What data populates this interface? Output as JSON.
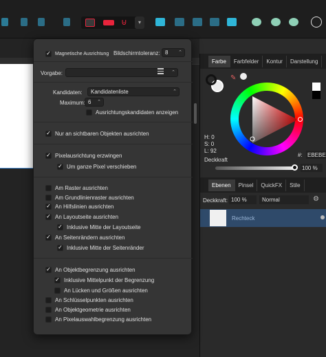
{
  "toolbar": {
    "dropdown_arrow": "▾",
    "user_icon": "user-icon"
  },
  "snapping": {
    "magnetic_label": "Magnetische Ausrichtung",
    "tolerance_label": "Bildschirmtoleranz:",
    "tolerance_value": "8",
    "preset_label": "Vorgabe:",
    "preset_value": "",
    "candidates_label": "Kandidaten:",
    "candidates_value": "Kandidatenliste",
    "maximum_label": "Maximum:",
    "maximum_value": "6",
    "show_candidates_label": "Ausrichtungskandidaten anzeigen",
    "visible_only_label": "Nur an sichtbaren Objekten ausrichten",
    "pixel_align_label": "Pixelausrichtung erzwingen",
    "whole_pixels_label": "Um ganze Pixel verschieben",
    "grid_label": "Am Raster ausrichten",
    "baseline_grid_label": "Am Grundlinienraster ausrichten",
    "guides_label": "An Hilfslinien ausrichten",
    "layout_label": "An Layoutseite ausrichten",
    "layout_mid_label": "Inklusive Mitte der Layoutseite",
    "page_edges_label": "An Seitenrändern ausrichten",
    "page_edges_mid_label": "Inklusive Mitte der Seitenränder",
    "object_bounds_label": "An Objektbegrenzung ausrichten",
    "bounds_mid_label": "Inklusive Mittelpunkt der Begrenzung",
    "gaps_label": "An Lücken und Größen ausrichten",
    "keypoints_label": "An Schlüsselpunkten ausrichten",
    "geometry_label": "An Objektgeometrie ausrichten",
    "pixel_selection_label": "An Pixelauswahlbegrenzung ausrichten",
    "checked": "✓"
  },
  "color_panel": {
    "tabs": [
      "Farbe",
      "Farbfelder",
      "Kontur",
      "Darstellung"
    ],
    "h": "H: 0",
    "s": "S: 0",
    "l": "L: 92",
    "hex_prefix": "#:",
    "hex": "EBEBEB",
    "opacity_label": "Deckkraft",
    "opacity_value": "100 %"
  },
  "layers_panel": {
    "tabs": [
      "Ebenen",
      "Pinsel",
      "QuickFX",
      "Stile"
    ],
    "opacity_label": "Deckkraft:",
    "opacity_value": "100 %",
    "blend_mode": "Normal",
    "layer_name": "Rechteck"
  },
  "colors": {
    "accent_red": "#e8243c",
    "selection_blue": "#2f4a6a",
    "cyan_icons": "#2fb6d8"
  }
}
